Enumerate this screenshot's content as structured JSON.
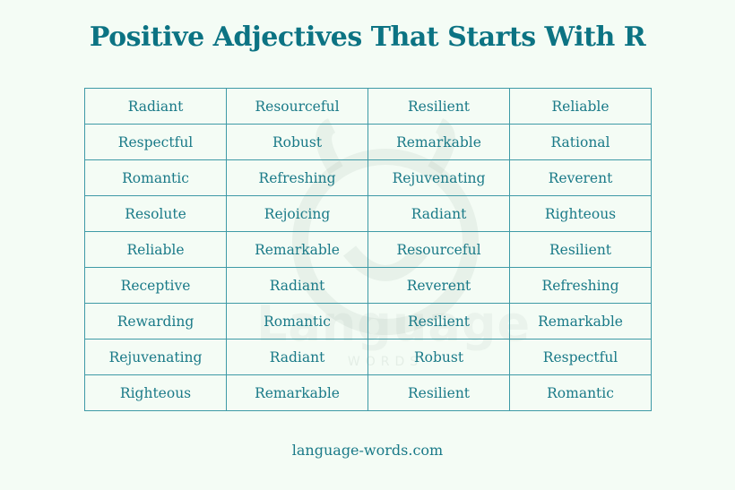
{
  "title": "Positive Adjectives That Starts With R",
  "watermark": {
    "text": "Language",
    "subtext": "WORDS"
  },
  "rows": [
    [
      "Radiant",
      "Resourceful",
      "Resilient",
      "Reliable"
    ],
    [
      "Respectful",
      "Robust",
      "Remarkable",
      "Rational"
    ],
    [
      "Romantic",
      "Refreshing",
      "Rejuvenating",
      "Reverent"
    ],
    [
      "Resolute",
      "Rejoicing",
      "Radiant",
      "Righteous"
    ],
    [
      "Reliable",
      "Remarkable",
      "Resourceful",
      "Resilient"
    ],
    [
      "Receptive",
      "Radiant",
      "Reverent",
      "Refreshing"
    ],
    [
      "Rewarding",
      "Romantic",
      "Resilient",
      "Remarkable"
    ],
    [
      "Rejuvenating",
      "Radiant",
      "Robust",
      "Respectful"
    ],
    [
      "Righteous",
      "Remarkable",
      "Resilient",
      "Romantic"
    ]
  ],
  "footer": "language-words.com",
  "colors": {
    "accent": "#0c7383",
    "text": "#1a7a88",
    "border": "#3e9aa6",
    "background": "#f4fcf5"
  }
}
